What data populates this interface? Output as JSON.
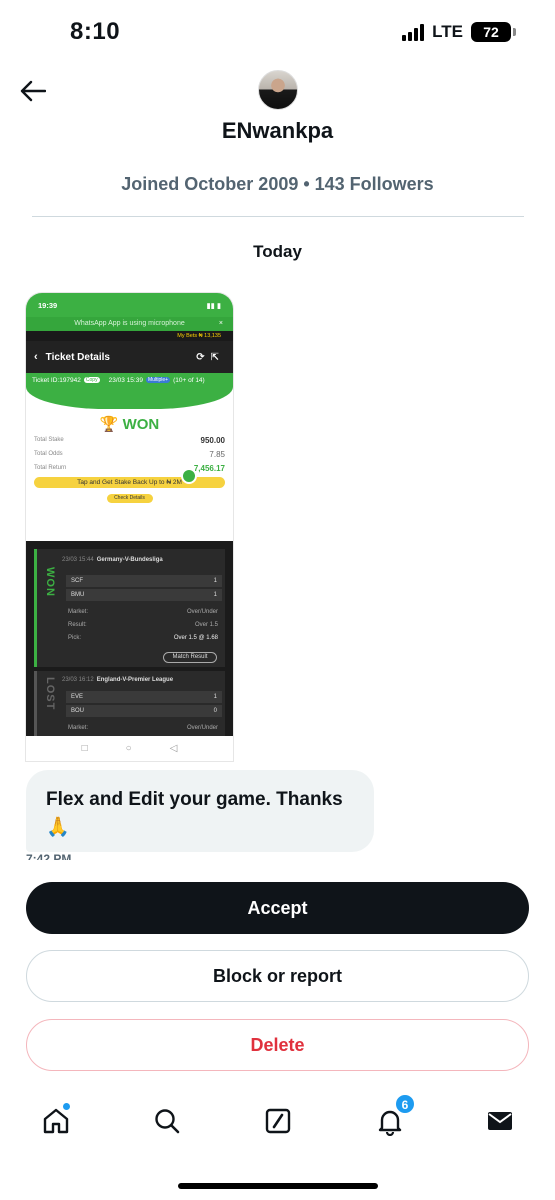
{
  "status_bar": {
    "time": "8:10",
    "network": "LTE",
    "battery": "72"
  },
  "header": {
    "display_name": "ENwankpa",
    "cut_text": "ENwankpa"
  },
  "profile": {
    "joined": "Joined October 2009 • 143 Followers"
  },
  "conversation": {
    "day_label": "Today"
  },
  "attachment": {
    "phone_time": "19:39",
    "whatsapp_banner": "WhatsApp App is using microphone",
    "my_bets": "My Bets  ₦ 13,135",
    "title": "Ticket Details",
    "ticket_id": "Ticket ID:197942",
    "copy": "Copy",
    "ticket_date": "23/03 15:39",
    "multiple": "Multiple+",
    "count": "(10+ of 14)",
    "won": "WON",
    "stake_label": "Total Stake",
    "stake_value": "950.00",
    "odds_label": "Total Odds",
    "odds_value": "7.85",
    "return_label": "Total Return",
    "return_value": "7,456.17",
    "promo": "Tap and Get Stake Back Up to ₦ 2M",
    "check": "Check Details",
    "match1": {
      "status": "WON",
      "time": "23/03 15:44",
      "league": "Germany-V-Bundesliga",
      "home": "SCF",
      "home_score": "1",
      "away": "BMU",
      "away_score": "1",
      "market_label": "Market:",
      "market": "Over/Under",
      "result_label": "Result:",
      "result": "Over 1.5",
      "pick_label": "Pick:",
      "pick": "Over 1.5 @ 1.68",
      "button": "Match Result"
    },
    "match2": {
      "status": "LOST",
      "time": "23/03 16:12",
      "league": "England-V-Premier League",
      "home": "EVE",
      "home_score": "1",
      "away": "BOU",
      "away_score": "0",
      "market_label": "Market:",
      "market": "Over/Under"
    }
  },
  "message": {
    "text": "Flex and Edit your game. Thanks",
    "emoji": "🙏",
    "time": "7:42 PM"
  },
  "actions": {
    "accept": "Accept",
    "block": "Block or report",
    "delete": "Delete"
  },
  "bottom_nav": {
    "notifications_badge": "6"
  },
  "colors": {
    "accent": "#1d9bf0",
    "danger": "#e0313d",
    "brand_green": "#3cb043"
  }
}
